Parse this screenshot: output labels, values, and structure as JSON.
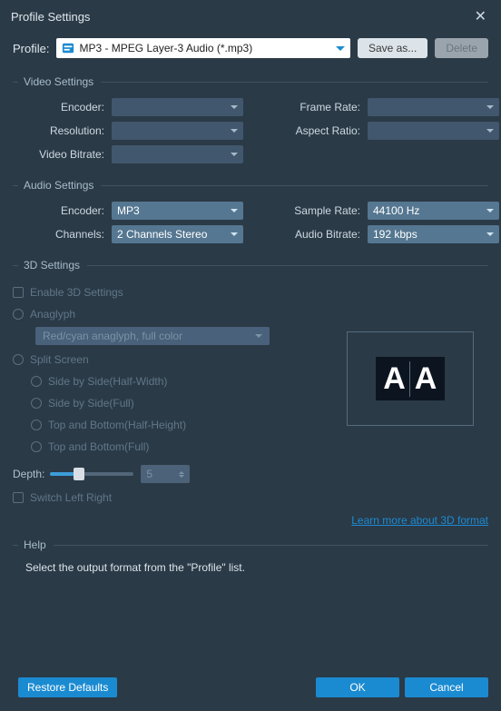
{
  "window": {
    "title": "Profile Settings"
  },
  "profile": {
    "label": "Profile:",
    "value": "MP3 - MPEG Layer-3 Audio (*.mp3)",
    "save_as": "Save as...",
    "delete": "Delete"
  },
  "video": {
    "legend": "Video Settings",
    "encoder_label": "Encoder:",
    "encoder": "",
    "resolution_label": "Resolution:",
    "resolution": "",
    "bitrate_label": "Video Bitrate:",
    "bitrate": "",
    "framerate_label": "Frame Rate:",
    "framerate": "",
    "aspect_label": "Aspect Ratio:",
    "aspect": ""
  },
  "audio": {
    "legend": "Audio Settings",
    "encoder_label": "Encoder:",
    "encoder": "MP3",
    "channels_label": "Channels:",
    "channels": "2 Channels Stereo",
    "samplerate_label": "Sample Rate:",
    "samplerate": "44100 Hz",
    "bitrate_label": "Audio Bitrate:",
    "bitrate": "192 kbps"
  },
  "three_d": {
    "legend": "3D Settings",
    "enable": "Enable 3D Settings",
    "anaglyph": "Anaglyph",
    "anaglyph_mode": "Red/cyan anaglyph, full color",
    "split": "Split Screen",
    "sbs_half": "Side by Side(Half-Width)",
    "sbs_full": "Side by Side(Full)",
    "tb_half": "Top and Bottom(Half-Height)",
    "tb_full": "Top and Bottom(Full)",
    "depth_label": "Depth:",
    "depth_value": "5",
    "switch_lr": "Switch Left Right",
    "learn_more": "Learn more about 3D format"
  },
  "help": {
    "legend": "Help",
    "text": "Select the output format from the \"Profile\" list."
  },
  "footer": {
    "restore": "Restore Defaults",
    "ok": "OK",
    "cancel": "Cancel"
  }
}
